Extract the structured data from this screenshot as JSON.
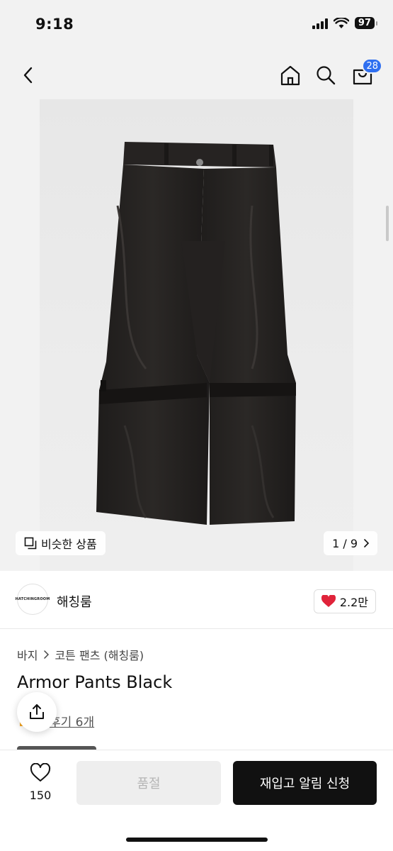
{
  "status": {
    "time": "9:18",
    "battery": "97"
  },
  "nav": {
    "cart_count": "28"
  },
  "gallery": {
    "similar_label": "비슷한 상품",
    "pager": "1 / 9"
  },
  "brand": {
    "logo_text": "HATCHINGROOM",
    "name": "해칭룸",
    "likes": "2.2만"
  },
  "breadcrumb": [
    "바지",
    "코튼 팬츠 (해칭룸)"
  ],
  "product": {
    "title": "Armor Pants Black",
    "review_link": "후기 6개"
  },
  "bottom": {
    "wish_count": "150",
    "soldout_label": "품절",
    "restock_label": "재입고 알림 신청"
  },
  "colors": {
    "accent_badge": "#2f6ff0",
    "heart": "#e0233a",
    "primary_button": "#111111"
  }
}
